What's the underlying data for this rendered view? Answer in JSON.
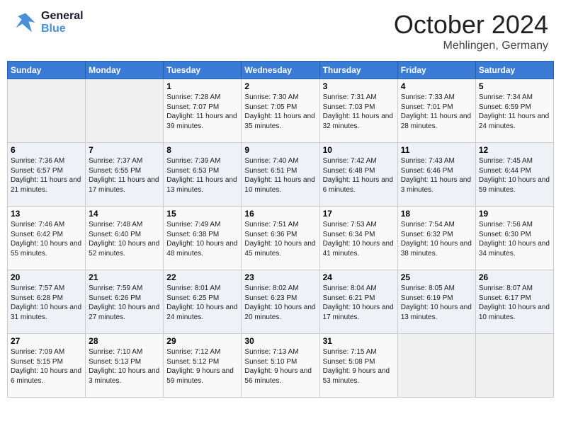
{
  "header": {
    "logo_general": "General",
    "logo_blue": "Blue",
    "month": "October 2024",
    "location": "Mehlingen, Germany"
  },
  "days_of_week": [
    "Sunday",
    "Monday",
    "Tuesday",
    "Wednesday",
    "Thursday",
    "Friday",
    "Saturday"
  ],
  "weeks": [
    [
      {
        "day": "",
        "info": ""
      },
      {
        "day": "",
        "info": ""
      },
      {
        "day": "1",
        "info": "Sunrise: 7:28 AM\nSunset: 7:07 PM\nDaylight: 11 hours and 39 minutes."
      },
      {
        "day": "2",
        "info": "Sunrise: 7:30 AM\nSunset: 7:05 PM\nDaylight: 11 hours and 35 minutes."
      },
      {
        "day": "3",
        "info": "Sunrise: 7:31 AM\nSunset: 7:03 PM\nDaylight: 11 hours and 32 minutes."
      },
      {
        "day": "4",
        "info": "Sunrise: 7:33 AM\nSunset: 7:01 PM\nDaylight: 11 hours and 28 minutes."
      },
      {
        "day": "5",
        "info": "Sunrise: 7:34 AM\nSunset: 6:59 PM\nDaylight: 11 hours and 24 minutes."
      }
    ],
    [
      {
        "day": "6",
        "info": "Sunrise: 7:36 AM\nSunset: 6:57 PM\nDaylight: 11 hours and 21 minutes."
      },
      {
        "day": "7",
        "info": "Sunrise: 7:37 AM\nSunset: 6:55 PM\nDaylight: 11 hours and 17 minutes."
      },
      {
        "day": "8",
        "info": "Sunrise: 7:39 AM\nSunset: 6:53 PM\nDaylight: 11 hours and 13 minutes."
      },
      {
        "day": "9",
        "info": "Sunrise: 7:40 AM\nSunset: 6:51 PM\nDaylight: 11 hours and 10 minutes."
      },
      {
        "day": "10",
        "info": "Sunrise: 7:42 AM\nSunset: 6:48 PM\nDaylight: 11 hours and 6 minutes."
      },
      {
        "day": "11",
        "info": "Sunrise: 7:43 AM\nSunset: 6:46 PM\nDaylight: 11 hours and 3 minutes."
      },
      {
        "day": "12",
        "info": "Sunrise: 7:45 AM\nSunset: 6:44 PM\nDaylight: 10 hours and 59 minutes."
      }
    ],
    [
      {
        "day": "13",
        "info": "Sunrise: 7:46 AM\nSunset: 6:42 PM\nDaylight: 10 hours and 55 minutes."
      },
      {
        "day": "14",
        "info": "Sunrise: 7:48 AM\nSunset: 6:40 PM\nDaylight: 10 hours and 52 minutes."
      },
      {
        "day": "15",
        "info": "Sunrise: 7:49 AM\nSunset: 6:38 PM\nDaylight: 10 hours and 48 minutes."
      },
      {
        "day": "16",
        "info": "Sunrise: 7:51 AM\nSunset: 6:36 PM\nDaylight: 10 hours and 45 minutes."
      },
      {
        "day": "17",
        "info": "Sunrise: 7:53 AM\nSunset: 6:34 PM\nDaylight: 10 hours and 41 minutes."
      },
      {
        "day": "18",
        "info": "Sunrise: 7:54 AM\nSunset: 6:32 PM\nDaylight: 10 hours and 38 minutes."
      },
      {
        "day": "19",
        "info": "Sunrise: 7:56 AM\nSunset: 6:30 PM\nDaylight: 10 hours and 34 minutes."
      }
    ],
    [
      {
        "day": "20",
        "info": "Sunrise: 7:57 AM\nSunset: 6:28 PM\nDaylight: 10 hours and 31 minutes."
      },
      {
        "day": "21",
        "info": "Sunrise: 7:59 AM\nSunset: 6:26 PM\nDaylight: 10 hours and 27 minutes."
      },
      {
        "day": "22",
        "info": "Sunrise: 8:01 AM\nSunset: 6:25 PM\nDaylight: 10 hours and 24 minutes."
      },
      {
        "day": "23",
        "info": "Sunrise: 8:02 AM\nSunset: 6:23 PM\nDaylight: 10 hours and 20 minutes."
      },
      {
        "day": "24",
        "info": "Sunrise: 8:04 AM\nSunset: 6:21 PM\nDaylight: 10 hours and 17 minutes."
      },
      {
        "day": "25",
        "info": "Sunrise: 8:05 AM\nSunset: 6:19 PM\nDaylight: 10 hours and 13 minutes."
      },
      {
        "day": "26",
        "info": "Sunrise: 8:07 AM\nSunset: 6:17 PM\nDaylight: 10 hours and 10 minutes."
      }
    ],
    [
      {
        "day": "27",
        "info": "Sunrise: 7:09 AM\nSunset: 5:15 PM\nDaylight: 10 hours and 6 minutes."
      },
      {
        "day": "28",
        "info": "Sunrise: 7:10 AM\nSunset: 5:13 PM\nDaylight: 10 hours and 3 minutes."
      },
      {
        "day": "29",
        "info": "Sunrise: 7:12 AM\nSunset: 5:12 PM\nDaylight: 9 hours and 59 minutes."
      },
      {
        "day": "30",
        "info": "Sunrise: 7:13 AM\nSunset: 5:10 PM\nDaylight: 9 hours and 56 minutes."
      },
      {
        "day": "31",
        "info": "Sunrise: 7:15 AM\nSunset: 5:08 PM\nDaylight: 9 hours and 53 minutes."
      },
      {
        "day": "",
        "info": ""
      },
      {
        "day": "",
        "info": ""
      }
    ]
  ]
}
